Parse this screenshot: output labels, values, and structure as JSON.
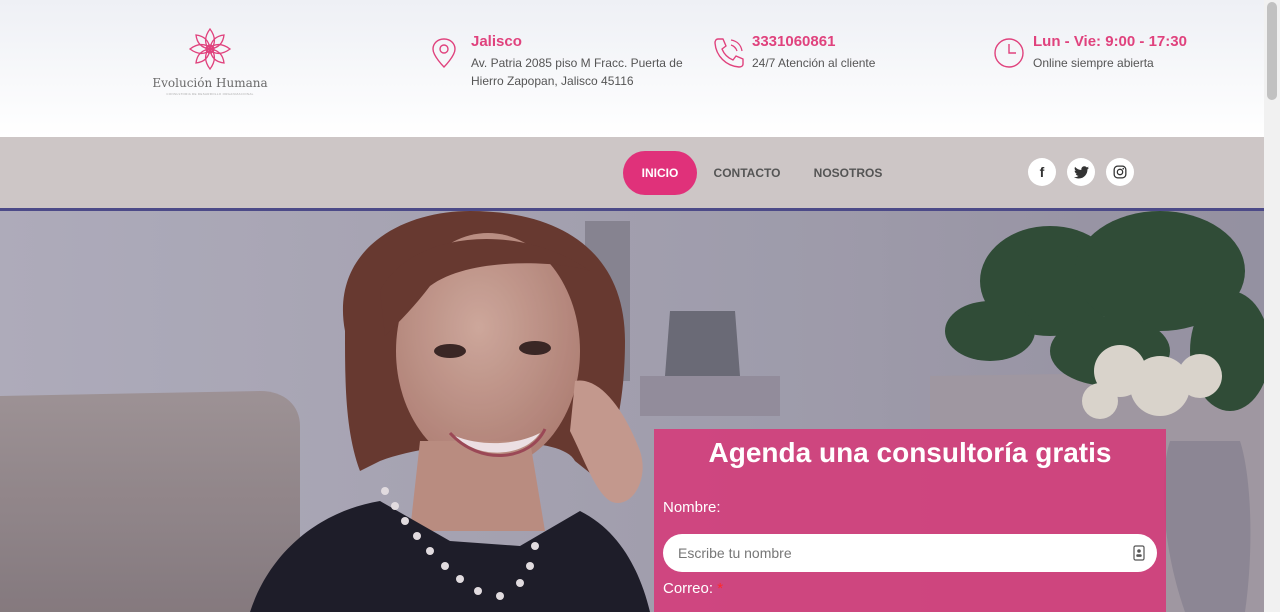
{
  "brand": {
    "name": "Evolución Humana",
    "tagline": "CONSULTORIA DE DESARROLLO ORGANIZACIONAL",
    "color": "#e0427d"
  },
  "contact": {
    "location": {
      "title": "Jalisco",
      "line1": "Av. Patria 2085 piso M Fracc. Puerta de",
      "line2": "Hierro Zapopan, Jalisco 45116",
      "icon": "map-pin-icon"
    },
    "phone": {
      "title": "3331060861",
      "subtitle": "24/7 Atención al cliente",
      "icon": "phone-icon"
    },
    "hours": {
      "title": "Lun - Vie: 9:00 - 17:30",
      "subtitle": "Online siempre abierta",
      "icon": "clock-icon"
    }
  },
  "nav": {
    "items": [
      {
        "label": "INICIO",
        "active": true
      },
      {
        "label": "CONTACTO",
        "active": false
      },
      {
        "label": "NOSOTROS",
        "active": false
      }
    ],
    "active_color": "#e0317a"
  },
  "social": {
    "facebook": "f",
    "twitter": "twitter-icon",
    "instagram": "instagram-icon"
  },
  "form": {
    "title": "Agenda una consultoría gratis",
    "name_label": "Nombre:",
    "name_placeholder": "Escribe tu nombre",
    "email_label": "Correo:",
    "required_mark": "*",
    "color": "#d63878"
  }
}
